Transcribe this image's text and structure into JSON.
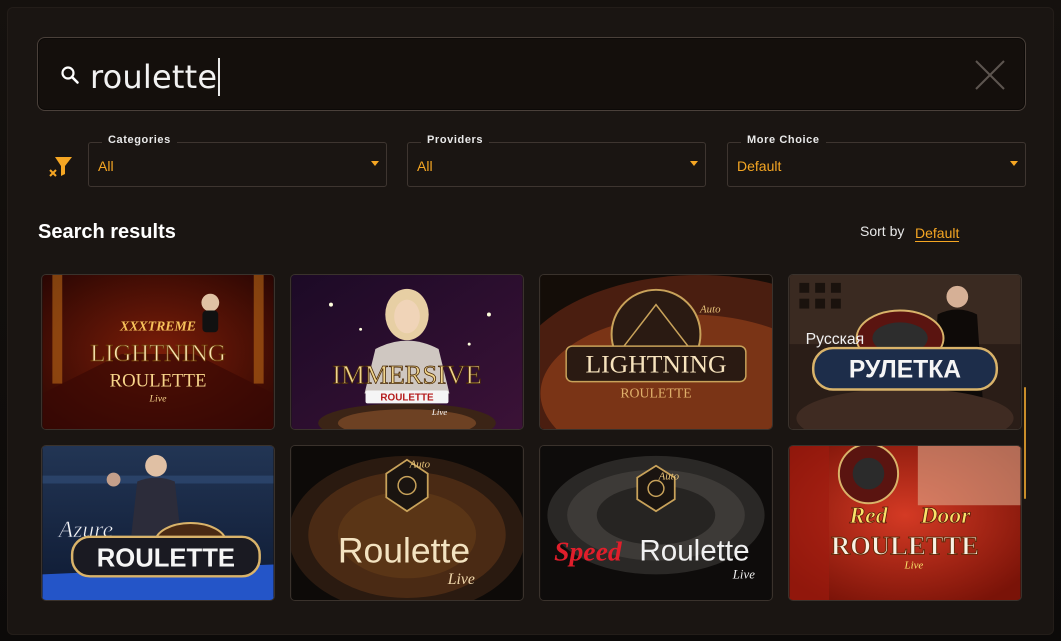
{
  "search": {
    "value": "roulette"
  },
  "filters": {
    "categories": {
      "label": "Categories",
      "value": "All"
    },
    "providers": {
      "label": "Providers",
      "value": "All"
    },
    "more_choice": {
      "label": "More Choice",
      "value": "Default"
    }
  },
  "results": {
    "title": "Search results",
    "sort_label": "Sort by",
    "sort_value": "Default"
  },
  "games": [
    {
      "line1": "XXXTREME",
      "line2": "LIGHTNING",
      "line3": "ROULETTE",
      "line4": "Live"
    },
    {
      "line1": "IMMERSIVE",
      "line2": "ROULETTE",
      "line3": "Live"
    },
    {
      "line1": "Auto",
      "line2": "LIGHTNING",
      "line3": "ROULETTE"
    },
    {
      "line1": "Русская",
      "line2": "РУЛЕТКА"
    },
    {
      "line1": "Azure",
      "line2": "ROULETTE"
    },
    {
      "line1": "Auto",
      "line2": "Roulette",
      "line3": "Live"
    },
    {
      "line1": "Auto",
      "line2": "Speed",
      "line3": "Roulette",
      "line4": "Live"
    },
    {
      "line1": "Red",
      "line2": "Door",
      "line3": "ROULETTE",
      "line4": "Live"
    }
  ],
  "colors": {
    "accent": "#f5a623",
    "modal_bg": "#1a1512",
    "border": "#3e3530"
  }
}
